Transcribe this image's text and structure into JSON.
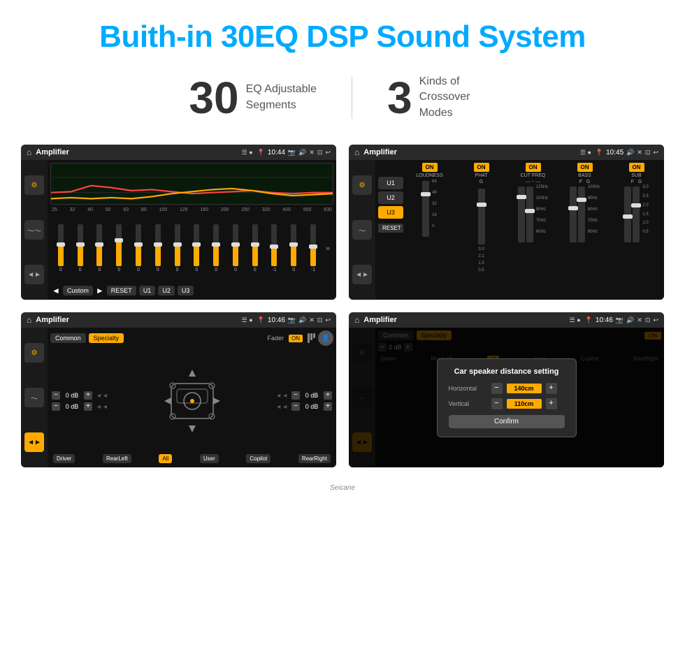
{
  "header": {
    "title": "Buith-in 30EQ DSP Sound System"
  },
  "stats": [
    {
      "number": "30",
      "label": "EQ Adjustable\nSegments"
    },
    {
      "number": "3",
      "label": "Kinds of\nCrossover Modes"
    }
  ],
  "screen1": {
    "status": {
      "app": "Amplifier",
      "time": "10:44"
    },
    "freq_labels": [
      "25",
      "32",
      "40",
      "50",
      "63",
      "80",
      "100",
      "125",
      "160",
      "200",
      "250",
      "320",
      "400",
      "500",
      "630"
    ],
    "sliders": [
      0,
      0,
      0,
      5,
      0,
      0,
      0,
      0,
      0,
      0,
      0,
      -1,
      0,
      -1
    ],
    "buttons": [
      "Custom",
      "RESET",
      "U1",
      "U2",
      "U3"
    ]
  },
  "screen2": {
    "status": {
      "app": "Amplifier",
      "time": "10:45"
    },
    "presets": [
      "U1",
      "U2",
      "U3"
    ],
    "active_preset": "U3",
    "bands": [
      {
        "label": "LOUDNESS",
        "on": true
      },
      {
        "label": "PHAT",
        "on": true
      },
      {
        "label": "CUT FREQ",
        "on": true
      },
      {
        "label": "BASS",
        "on": true
      },
      {
        "label": "SUB",
        "on": true
      }
    ],
    "reset_label": "RESET"
  },
  "screen3": {
    "status": {
      "app": "Amplifier",
      "time": "10:46"
    },
    "common_label": "Common",
    "specialty_label": "Specialty",
    "fader_label": "Fader",
    "fader_on": "ON",
    "positions": [
      "Driver",
      "RearLeft",
      "All",
      "Copilot",
      "RearRight",
      "User"
    ],
    "db_labels": [
      "0 dB",
      "0 dB",
      "0 dB",
      "0 dB"
    ]
  },
  "screen4": {
    "status": {
      "app": "Amplifier",
      "time": "10:46"
    },
    "common_label": "Common",
    "specialty_label": "Specialty",
    "dialog": {
      "title": "Car speaker distance setting",
      "horizontal_label": "Horizontal",
      "horizontal_value": "140cm",
      "vertical_label": "Vertical",
      "vertical_value": "110cm",
      "confirm_label": "Confirm",
      "db_labels": [
        "0 dB",
        "0 dB"
      ]
    }
  },
  "watermark": "Seicane",
  "icons": {
    "home": "⌂",
    "play": "▶",
    "back": "↺",
    "eq": "≡",
    "wave": "〜",
    "speaker": "♪",
    "bluetooth": "⚡",
    "minus": "−",
    "plus": "+"
  }
}
